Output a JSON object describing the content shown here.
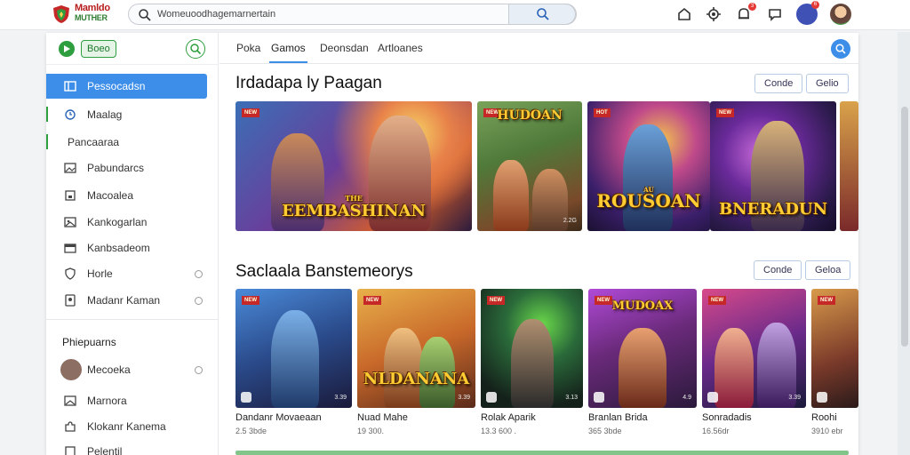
{
  "header": {
    "logo_line1": "Mamldo",
    "logo_line2": "MUTHER",
    "search_placeholder": "Womeuoodhagemarnertain",
    "notification_badge": "3",
    "notification_badge_2": "6"
  },
  "sidebar": {
    "brand_pill": "Boeo",
    "items": [
      {
        "label": "Pessocadsn",
        "icon": "grid-icon",
        "active": true
      },
      {
        "label": "Maalag",
        "icon": "clock-icon",
        "active": false
      },
      {
        "label": "Pancaaraa",
        "icon": "",
        "active": false
      },
      {
        "label": "Pabundarcs",
        "icon": "photo-icon",
        "active": false
      },
      {
        "label": "Macoalea",
        "icon": "square-icon",
        "active": false
      },
      {
        "label": "Kankogarlan",
        "icon": "image-icon",
        "active": false
      },
      {
        "label": "Kanbsadeom",
        "icon": "card-icon",
        "active": false
      },
      {
        "label": "Horle",
        "icon": "shield-icon",
        "active": false
      },
      {
        "label": "Madanr Kaman",
        "icon": "badge-icon",
        "active": false
      }
    ],
    "section_title": "Phiepuarns",
    "channels": [
      {
        "label": "Mecoeka"
      },
      {
        "label": "Marnora"
      },
      {
        "label": "Klokanr Kanema"
      },
      {
        "label": "Pelentil"
      }
    ]
  },
  "tabs": [
    {
      "label": "Poka"
    },
    {
      "label": "Gamos"
    },
    {
      "label": "Deonsdan"
    },
    {
      "label": "Artloanes"
    }
  ],
  "section1": {
    "title": "Irdadapa ly Paagan",
    "btn1": "Conde",
    "btn2": "Gelio",
    "cards": [
      {
        "tag": "NEW",
        "title": "EEMBASHINAN",
        "subtitle": "THE",
        "num": ""
      },
      {
        "tag": "NEW",
        "title": "HUDOAN",
        "subtitle": "",
        "num": "2.2G"
      },
      {
        "tag": "HOT",
        "title": "ROUSOAN",
        "subtitle": "AU",
        "num": ""
      },
      {
        "tag": "NEW",
        "title": "BNERADUN",
        "subtitle": "",
        "num": ""
      }
    ]
  },
  "section2": {
    "title": "Saclaala Banstemeorys",
    "btn1": "Conde",
    "btn2": "Geloa",
    "games": [
      {
        "tag": "NEW",
        "name": "Dandanr Movaeaan",
        "meta": "2.5 3bde",
        "num": "3.39"
      },
      {
        "tag": "NEW",
        "name": "Nuad Mahe",
        "meta": "19 300.",
        "title": "NLDANANA",
        "num": "3.39"
      },
      {
        "tag": "NEW",
        "name": "Rolak Aparik",
        "meta": "13.3 600 .",
        "num": "3.13"
      },
      {
        "tag": "NEW",
        "name": "Branlan Brida",
        "meta": "365 3bde",
        "title": "MUDOAX",
        "num": "4.9"
      },
      {
        "tag": "NEW",
        "name": "Sonradadis",
        "meta": "16.56dr",
        "num": "3.39"
      },
      {
        "tag": "NEW",
        "name": "Roohi",
        "meta": "3910 ebr",
        "num": ""
      }
    ]
  },
  "colors": {
    "accent_blue": "#3d8ee8",
    "brand_green": "#2e9e3e",
    "tag_red": "#c62828"
  }
}
